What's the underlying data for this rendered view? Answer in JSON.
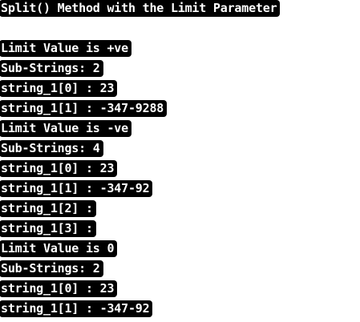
{
  "console": {
    "lines": [
      "Split() Method with the Limit Parameter",
      "",
      "Limit Value is +ve",
      "Sub-Strings: 2",
      "string_1[0] : 23",
      "string_1[1] : -347-9288",
      "Limit Value is -ve",
      "Sub-Strings: 4",
      "string_1[0] : 23",
      "string_1[1] : -347-92",
      "string_1[2] :",
      "string_1[3] :",
      "Limit Value is 0",
      "Sub-Strings: 2",
      "string_1[0] : 23",
      "string_1[1] : -347-92"
    ]
  }
}
